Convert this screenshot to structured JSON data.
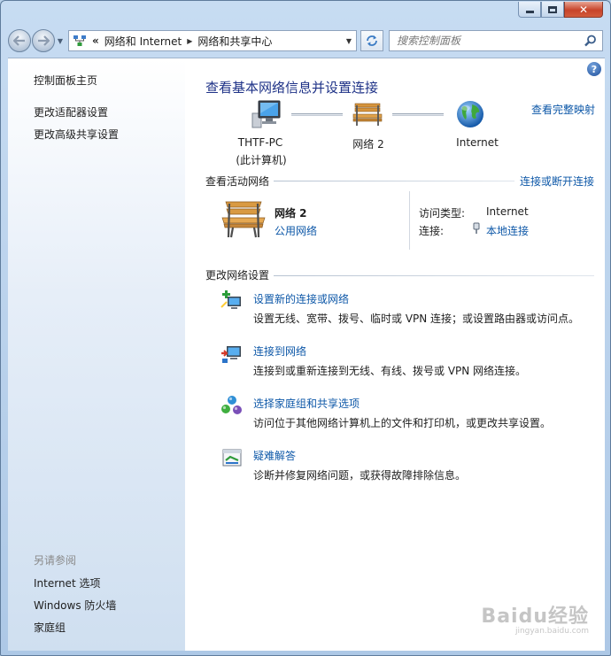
{
  "window": {
    "colors": {
      "title_text": "#1e3287",
      "link": "#0e58a8",
      "frame": "#b9d1ea"
    }
  },
  "address_bar": {
    "chevron": "«",
    "segments": [
      "网络和 Internet",
      "网络和共享中心"
    ]
  },
  "search": {
    "placeholder": "搜索控制面板"
  },
  "sidebar": {
    "links": [
      "控制面板主页",
      "更改适配器设置",
      "更改高级共享设置"
    ],
    "see_also_title": "另请参阅",
    "see_also": [
      "Internet 选项",
      "Windows 防火墙",
      "家庭组"
    ]
  },
  "main": {
    "title": "查看基本网络信息并设置连接",
    "full_map_link": "查看完整映射",
    "map": {
      "nodes": [
        {
          "label": "THTF-PC",
          "sublabel": "(此计算机)",
          "icon": "computer-icon"
        },
        {
          "label": "网络  2",
          "icon": "bench-icon"
        },
        {
          "label": "Internet",
          "icon": "globe-icon"
        }
      ]
    },
    "active_section": {
      "title": "查看活动网络",
      "action_link": "连接或断开连接",
      "network_name": "网络  2",
      "network_type": "公用网络",
      "access_type_label": "访问类型:",
      "access_type_value": "Internet",
      "connections_label": "连接:",
      "connections_value": "本地连接"
    },
    "change_section": {
      "title": "更改网络设置",
      "tasks": [
        {
          "link": "设置新的连接或网络",
          "desc": "设置无线、宽带、拨号、临时或 VPN 连接；或设置路由器或访问点。",
          "icon": "new-connection-icon"
        },
        {
          "link": "连接到网络",
          "desc": "连接到或重新连接到无线、有线、拨号或 VPN 网络连接。",
          "icon": "connect-network-icon"
        },
        {
          "link": "选择家庭组和共享选项",
          "desc": "访问位于其他网络计算机上的文件和打印机，或更改共享设置。",
          "icon": "homegroup-icon"
        },
        {
          "link": "疑难解答",
          "desc": "诊断并修复网络问题，或获得故障排除信息。",
          "icon": "troubleshoot-icon"
        }
      ]
    }
  },
  "watermark": {
    "main": "Baidu经验",
    "sub": "jingyan.baidu.com"
  }
}
